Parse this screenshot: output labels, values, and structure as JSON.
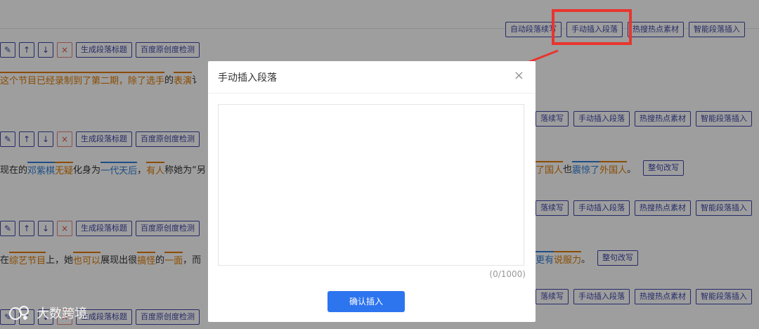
{
  "toolbar_right": {
    "auto_continue": "自动段落续写",
    "manual_insert": "手动插入段落",
    "hot_material": "热搜热点素材",
    "smart_insert": "智能段落插入",
    "auto_continue_partial": "落续写"
  },
  "para_tools": {
    "edit_icon": "pencil-icon",
    "up_icon": "arrow-up-icon",
    "down_icon": "arrow-down-icon",
    "delete_icon": "close-icon",
    "gen_title": "生成段落标题",
    "baidu_check": "百度原创度检测"
  },
  "paragraphs": {
    "p1": [
      "这个节目已经录制到了第二期，",
      "除了选手",
      "的",
      "表演",
      "讠"
    ],
    "p2_left": [
      "现在的",
      "邓紫棋",
      "无疑",
      "化身为",
      "一代天后",
      "，",
      "有人",
      "称她为“",
      "另"
    ],
    "p2_right": [
      "了",
      "国人",
      "也",
      "震惊了",
      "外国人",
      "。"
    ],
    "p3_left": [
      "在",
      "综艺节目",
      "上，她",
      "也可以",
      "展现出很",
      "搞怪",
      "的",
      "一面",
      "，",
      "而"
    ],
    "p3_right": [
      "更有",
      "说服力",
      "。"
    ],
    "rewrite": "整句改写"
  },
  "modal": {
    "title": "手动插入段落",
    "close_icon": "close-icon",
    "textarea_value": "",
    "counter": "(0/1000)",
    "confirm": "确认插入"
  },
  "watermark": {
    "text": "大数跨境",
    "logo": "logo-mark"
  },
  "colors": {
    "accent_blue": "#2d74ef",
    "outline_purple": "#3d46a8",
    "highlight_red": "#e8352f",
    "orange_word": "#e07b00",
    "blue_word": "#2f7ed8"
  }
}
